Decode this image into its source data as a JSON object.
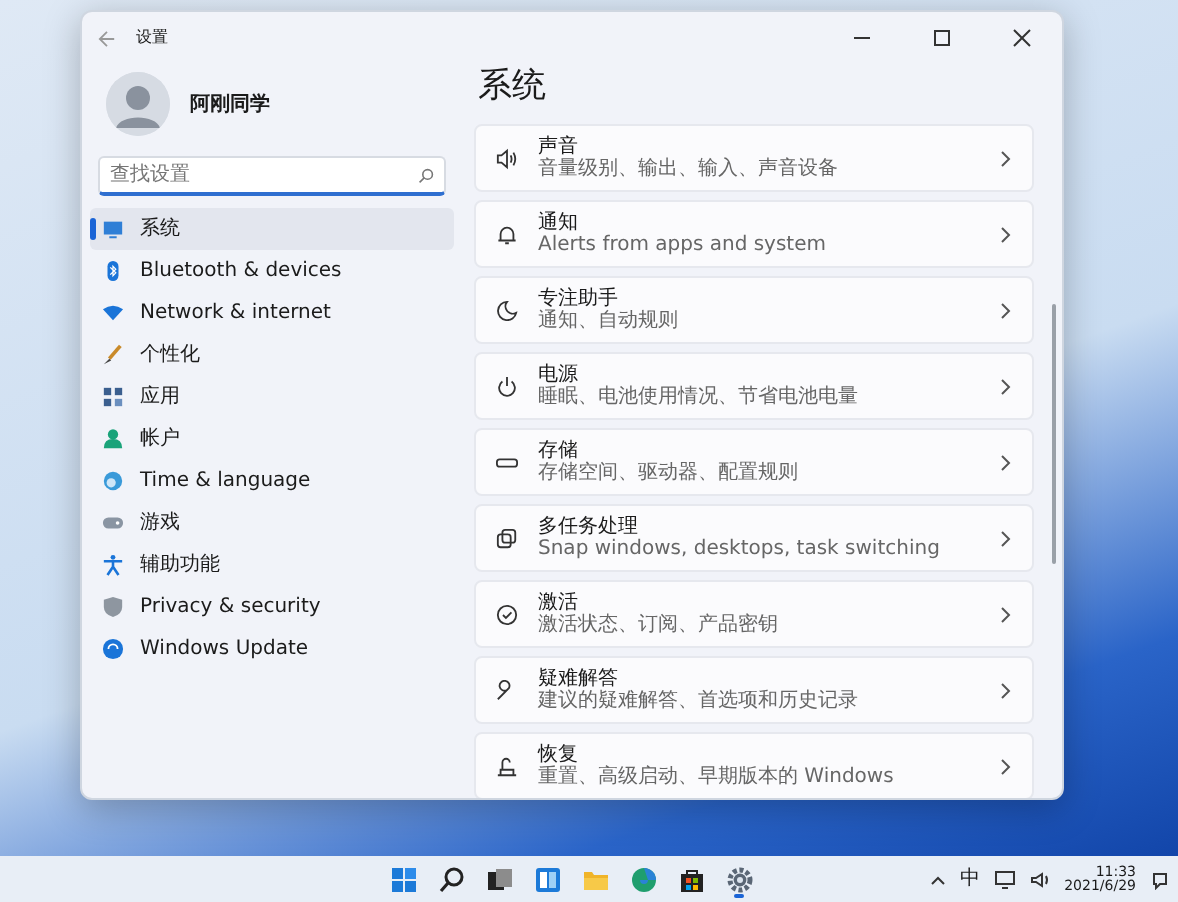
{
  "window": {
    "title": "设置"
  },
  "user": {
    "name": "阿刚同学"
  },
  "search": {
    "placeholder": "查找设置"
  },
  "sidebar": {
    "items": [
      {
        "label": "系统",
        "selected": true
      },
      {
        "label": "Bluetooth & devices",
        "selected": false
      },
      {
        "label": "Network & internet",
        "selected": false
      },
      {
        "label": "个性化",
        "selected": false
      },
      {
        "label": "应用",
        "selected": false
      },
      {
        "label": "帐户",
        "selected": false
      },
      {
        "label": "Time & language",
        "selected": false
      },
      {
        "label": "游戏",
        "selected": false
      },
      {
        "label": "辅助功能",
        "selected": false
      },
      {
        "label": "Privacy & security",
        "selected": false
      },
      {
        "label": "Windows Update",
        "selected": false
      }
    ]
  },
  "page_title": "系统",
  "settings": [
    {
      "title": "声音",
      "description": "音量级别、输出、输入、声音设备"
    },
    {
      "title": "通知",
      "description": "Alerts from apps and system"
    },
    {
      "title": "专注助手",
      "description": "通知、自动规则"
    },
    {
      "title": "电源",
      "description": "睡眠、电池使用情况、节省电池电量"
    },
    {
      "title": "存储",
      "description": "存储空间、驱动器、配置规则"
    },
    {
      "title": "多任务处理",
      "description": "Snap windows, desktops, task switching"
    },
    {
      "title": "激活",
      "description": "激活状态、订阅、产品密钥"
    },
    {
      "title": "疑难解答",
      "description": "建议的疑难解答、首选项和历史记录"
    },
    {
      "title": "恢复",
      "description": "重置、高级启动、早期版本的 Windows"
    }
  ],
  "taskbar": {
    "apps": [
      {
        "running": false
      },
      {
        "running": false
      },
      {
        "running": false
      },
      {
        "running": false
      },
      {
        "running": false
      },
      {
        "running": false
      },
      {
        "running": false
      },
      {
        "running": true
      }
    ]
  },
  "tray": {
    "ime": "中",
    "time": "11:33",
    "date": "2021/6/29"
  }
}
